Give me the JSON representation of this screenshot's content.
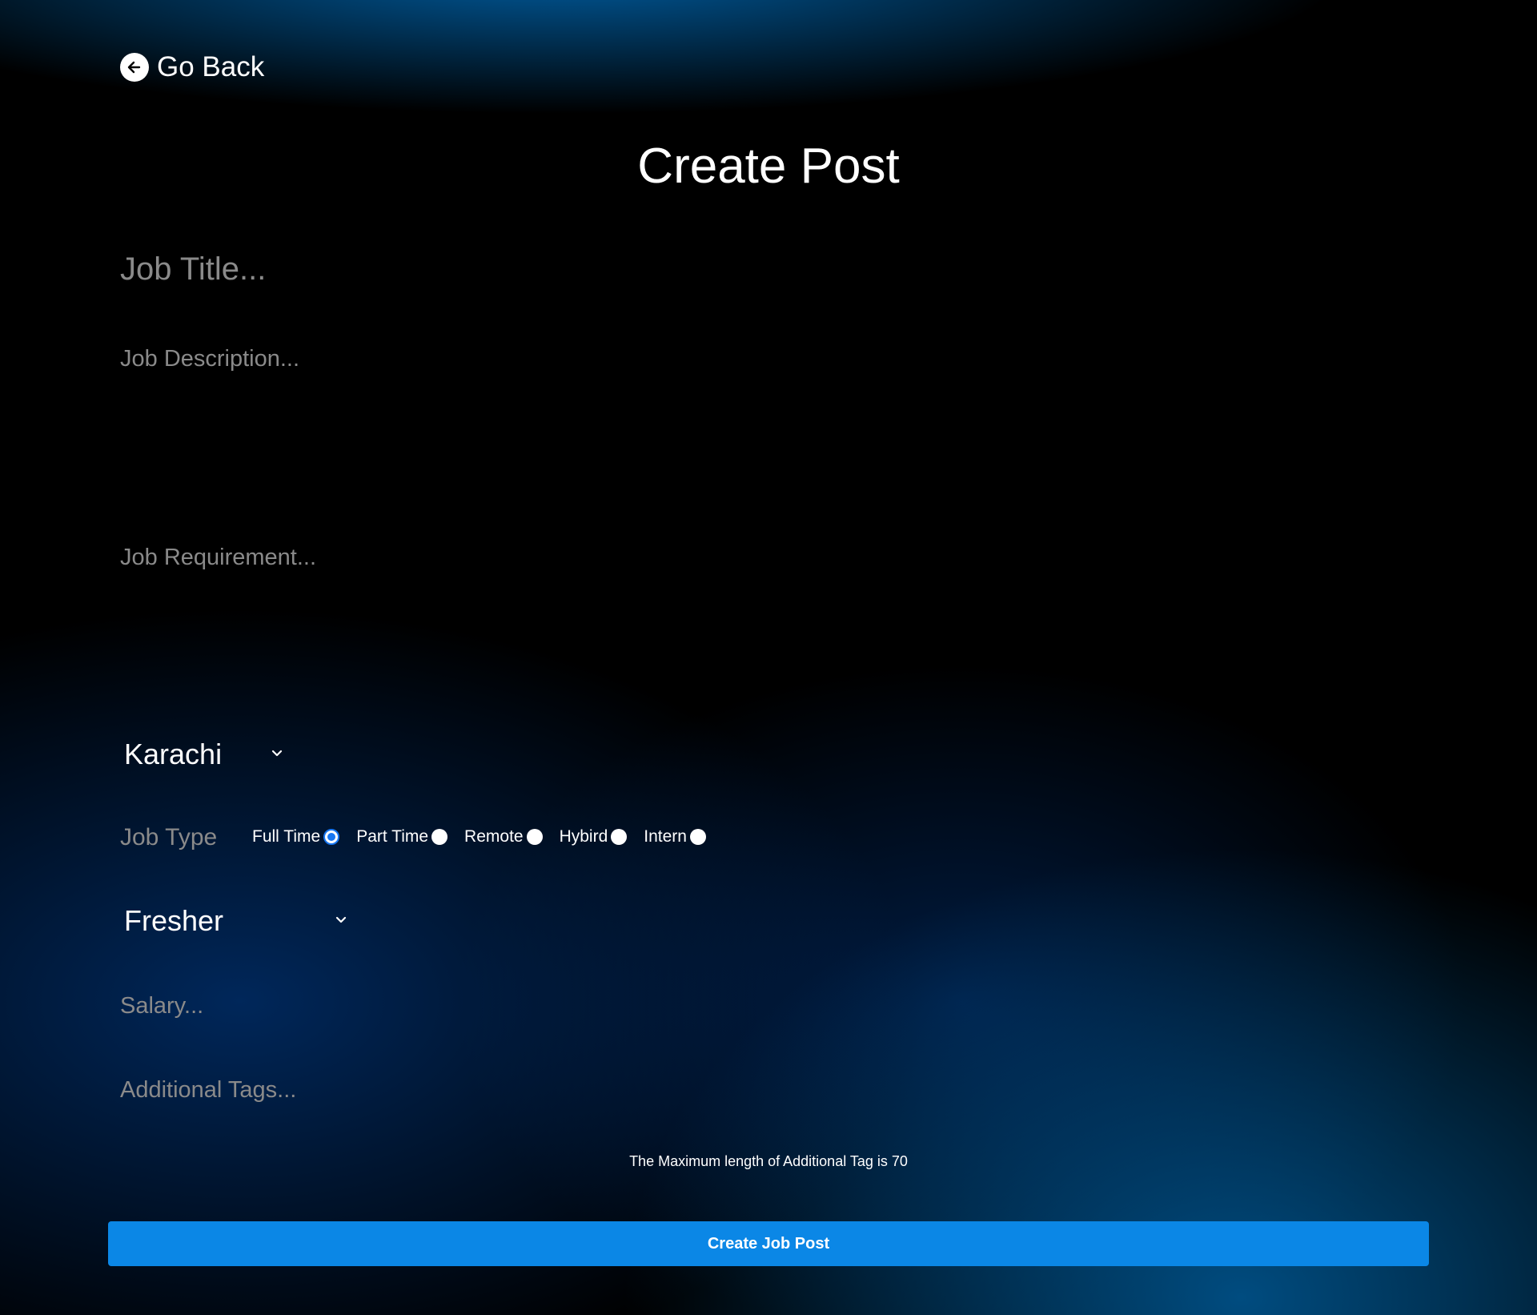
{
  "nav": {
    "back_label": "Go Back",
    "back_icon": "arrow-left-circle-icon"
  },
  "page": {
    "title": "Create Post"
  },
  "form": {
    "job_title": {
      "value": "",
      "placeholder": "Job Title..."
    },
    "job_description": {
      "value": "",
      "placeholder": "Job Description..."
    },
    "job_requirement": {
      "value": "",
      "placeholder": "Job Requirement..."
    },
    "city": {
      "selected": "Karachi",
      "icon": "chevron-down-icon"
    },
    "job_type": {
      "label": "Job Type",
      "options": [
        {
          "label": "Full Time",
          "checked": true
        },
        {
          "label": "Part Time",
          "checked": false
        },
        {
          "label": "Remote",
          "checked": false
        },
        {
          "label": "Hybird",
          "checked": false
        },
        {
          "label": "Intern",
          "checked": false
        }
      ]
    },
    "experience": {
      "selected": "Fresher",
      "icon": "chevron-down-icon"
    },
    "salary": {
      "value": "",
      "placeholder": "Salary..."
    },
    "additional_tags": {
      "value": "",
      "placeholder": "Additional Tags..."
    },
    "helper_text": "The Maximum length of Additional Tag is 70",
    "submit_label": "Create Job Post"
  },
  "colors": {
    "accent": "#0b87e6",
    "radio_checked": "#1877f2",
    "placeholder": "#8a8a8a",
    "background": "#000000"
  }
}
